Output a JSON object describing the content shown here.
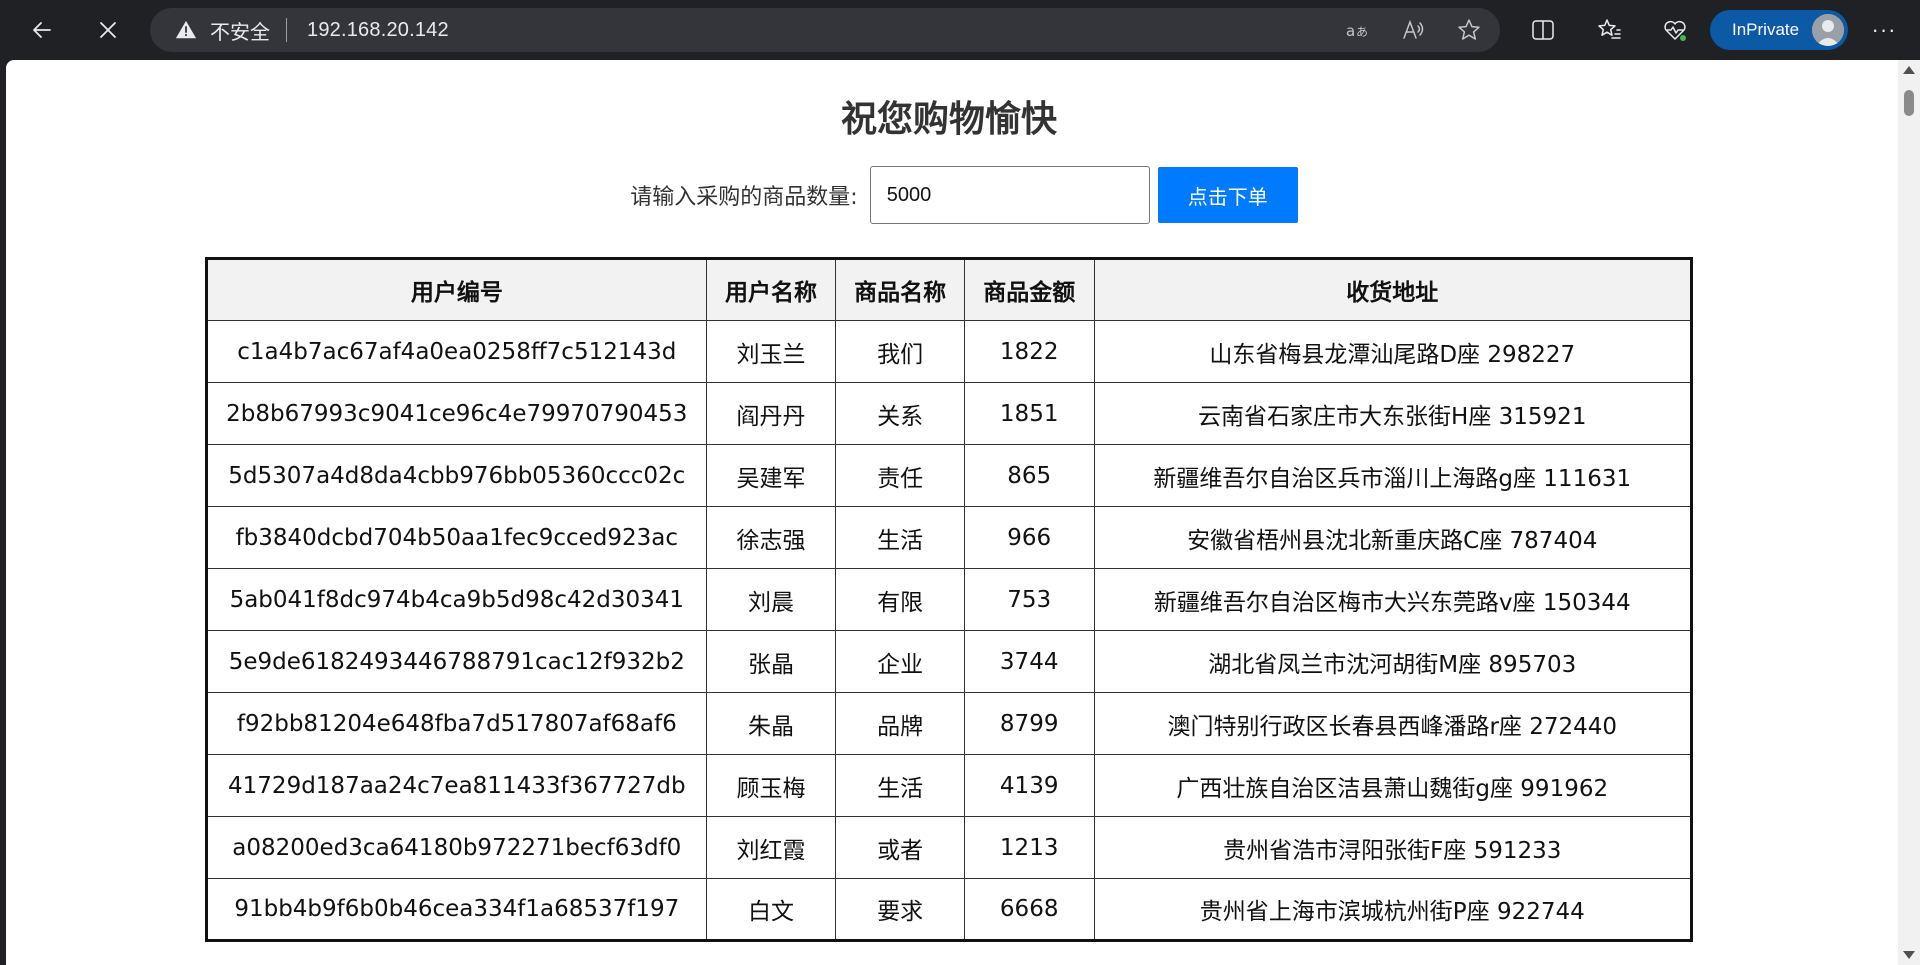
{
  "browser": {
    "security_label": "不安全",
    "url": "192.168.20.142",
    "inprivate_label": "InPrivate",
    "more_label": "···",
    "icons": [
      "back-icon",
      "stop-icon",
      "warning-icon",
      "read-aloud-icon",
      "translate-icon",
      "favorite-star-icon",
      "split-screen-icon",
      "favorites-icon",
      "browser-essentials-icon",
      "profile-avatar-icon",
      "more-icon"
    ]
  },
  "page": {
    "title": "祝您购物愉快",
    "quantity_label": "请输入采购的商品数量:",
    "quantity_value": "5000",
    "order_button": "点击下单"
  },
  "table": {
    "columns": [
      "用户编号",
      "用户名称",
      "商品名称",
      "商品金额",
      "收货地址"
    ],
    "rows": [
      [
        "c1a4b7ac67af4a0ea0258ff7c512143d",
        "刘玉兰",
        "我们",
        "1822",
        "山东省梅县龙潭汕尾路D座 298227"
      ],
      [
        "2b8b67993c9041ce96c4e79970790453",
        "阎丹丹",
        "关系",
        "1851",
        "云南省石家庄市大东张街H座 315921"
      ],
      [
        "5d5307a4d8da4cbb976bb05360ccc02c",
        "吴建军",
        "责任",
        "865",
        "新疆维吾尔自治区兵市淄川上海路g座 111631"
      ],
      [
        "fb3840dcbd704b50aa1fec9cced923ac",
        "徐志强",
        "生活",
        "966",
        "安徽省梧州县沈北新重庆路C座 787404"
      ],
      [
        "5ab041f8dc974b4ca9b5d98c42d30341",
        "刘晨",
        "有限",
        "753",
        "新疆维吾尔自治区梅市大兴东莞路v座 150344"
      ],
      [
        "5e9de6182493446788791cac12f932b2",
        "张晶",
        "企业",
        "3744",
        "湖北省凤兰市沈河胡街M座 895703"
      ],
      [
        "f92bb81204e648fba7d517807af68af6",
        "朱晶",
        "品牌",
        "8799",
        "澳门特别行政区长春县西峰潘路r座 272440"
      ],
      [
        "41729d187aa24c7ea811433f367727db",
        "顾玉梅",
        "生活",
        "4139",
        "广西壮族自治区洁县萧山魏街g座 991962"
      ],
      [
        "a08200ed3ca64180b972271becf63df0",
        "刘红霞",
        "或者",
        "1213",
        "贵州省浩市浔阳张街F座 591233"
      ],
      [
        "91bb4b9f6b0b46cea334f1a68537f197",
        "白文",
        "要求",
        "6668",
        "贵州省上海市滨城杭州街P座 922744"
      ]
    ]
  },
  "colors": {
    "chrome_bg": "#202124",
    "address_bar": "#33353a",
    "inprivate": "#0c59a6",
    "order_button": "#007bff",
    "header_bg": "#f2f2f2"
  }
}
